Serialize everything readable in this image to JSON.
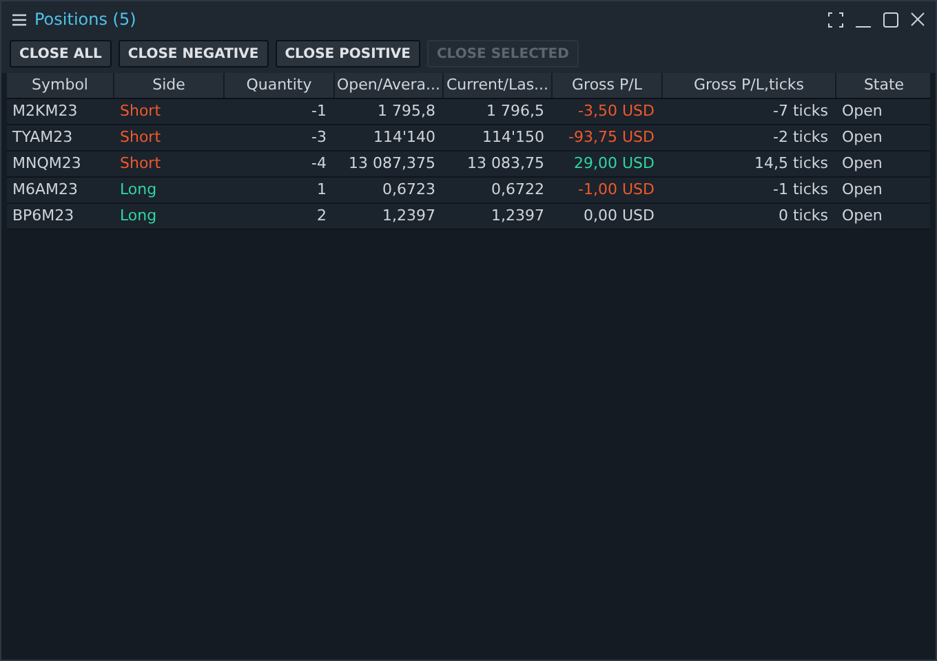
{
  "window": {
    "title": "Positions (5)"
  },
  "buttons": [
    {
      "label": "CLOSE ALL",
      "disabled": false
    },
    {
      "label": "CLOSE NEGATIVE",
      "disabled": false
    },
    {
      "label": "CLOSE POSITIVE",
      "disabled": false
    },
    {
      "label": "CLOSE SELECTED",
      "disabled": true
    }
  ],
  "table": {
    "columns": [
      "Symbol",
      "Side",
      "Quantity",
      "Open/Avera...",
      "Current/Las...",
      "Gross P/L",
      "Gross P/L,ticks",
      "State"
    ],
    "rows": [
      {
        "symbol": "M2KM23",
        "side": {
          "text": "Short",
          "color": "#f0592b"
        },
        "quantity": "-1",
        "open": "1 795,8",
        "current": "1 796,5",
        "gross_pl": {
          "text": "-3,50 USD",
          "color": "#f0592b"
        },
        "ticks": "-7 ticks",
        "state": "Open"
      },
      {
        "symbol": "TYAM23",
        "side": {
          "text": "Short",
          "color": "#f0592b"
        },
        "quantity": "-3",
        "open": "114'140",
        "current": "114'150",
        "gross_pl": {
          "text": "-93,75 USD",
          "color": "#f0592b"
        },
        "ticks": "-2 ticks",
        "state": "Open"
      },
      {
        "symbol": "MNQM23",
        "side": {
          "text": "Short",
          "color": "#f0592b"
        },
        "quantity": "-4",
        "open": "13 087,375",
        "current": "13 083,75",
        "gross_pl": {
          "text": "29,00 USD",
          "color": "#2fd6a0"
        },
        "ticks": "14,5 ticks",
        "state": "Open"
      },
      {
        "symbol": "M6AM23",
        "side": {
          "text": "Long",
          "color": "#2fd6a0"
        },
        "quantity": "1",
        "open": "0,6723",
        "current": "0,6722",
        "gross_pl": {
          "text": "-1,00 USD",
          "color": "#f0592b"
        },
        "ticks": "-1 ticks",
        "state": "Open"
      },
      {
        "symbol": "BP6M23",
        "side": {
          "text": "Long",
          "color": "#2fd6a0"
        },
        "quantity": "2",
        "open": "1,2397",
        "current": "1,2397",
        "gross_pl": {
          "text": "0,00 USD",
          "color": "#d0d4d8"
        },
        "ticks": "0 ticks",
        "state": "Open"
      }
    ]
  }
}
